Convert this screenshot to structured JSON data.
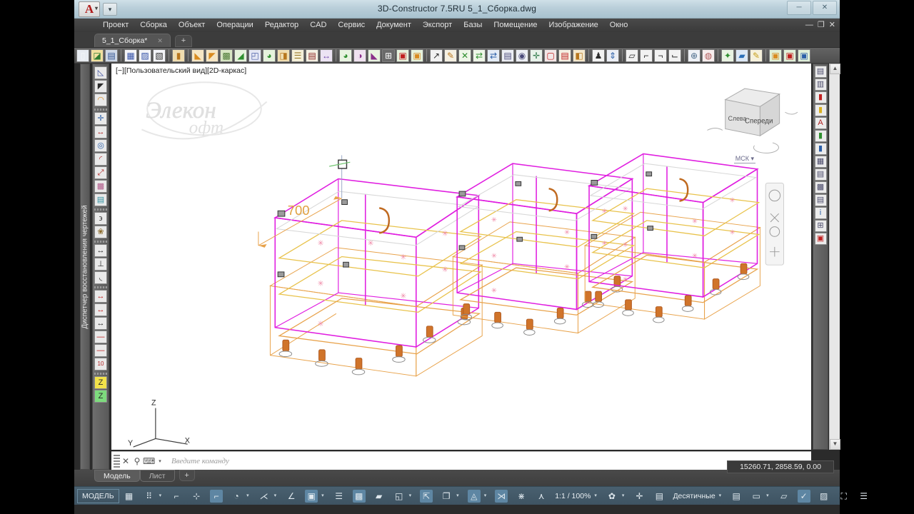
{
  "window": {
    "title": "3D-Constructor 7.5RU     5_1_Сборка.dwg",
    "app_button": "A",
    "app_caret": "▾",
    "qat_label": "▾",
    "min": "─",
    "max": "❐",
    "close": "✕",
    "inner_min": "—",
    "inner_max": "❐",
    "inner_close": "✕"
  },
  "menu": {
    "items": [
      "Проект",
      "Сборка",
      "Объект",
      "Операции",
      "Редактор",
      "CAD",
      "Сервис",
      "Документ",
      "Экспорт",
      "Базы",
      "Помещение",
      "Изображение",
      "Окно"
    ]
  },
  "tabs": {
    "items": [
      {
        "label": "5_1_Сборка*",
        "close": "✕"
      }
    ],
    "add": "+"
  },
  "toolbar": {
    "groups": [
      {
        "icons": [
          {
            "name": "new-file-icon",
            "glyph": "▯",
            "fg": "#f4f6fa",
            "bg": "#e8ecf2"
          },
          {
            "name": "open-file-icon",
            "glyph": "◪",
            "fg": "#2f7d32",
            "bg": "#f1e0a0"
          },
          {
            "name": "save-file-icon",
            "glyph": "▤",
            "fg": "#2b4f8e",
            "bg": "#cfd9e8"
          }
        ]
      },
      {
        "icons": [
          {
            "name": "object-box-icon",
            "glyph": "▦",
            "fg": "#3552a8",
            "bg": "#f3f4f8"
          },
          {
            "name": "object-edit-icon",
            "glyph": "▨",
            "fg": "#3552a8",
            "bg": "#f3f4f8"
          },
          {
            "name": "object-move-icon",
            "glyph": "▧",
            "fg": "#2c2c2c",
            "bg": "#f3f4f8"
          }
        ]
      },
      {
        "icons": [
          {
            "name": "panel-icon",
            "glyph": "▮",
            "fg": "#b8761d",
            "bg": "#f0ddb0"
          }
        ]
      },
      {
        "icons": [
          {
            "name": "contour-a-icon",
            "glyph": "◣",
            "fg": "#d98b20",
            "bg": "#f6e6c4"
          },
          {
            "name": "contour-b-icon",
            "glyph": "◤",
            "fg": "#d98b20",
            "bg": "#f6e6c4"
          },
          {
            "name": "texture-icon",
            "glyph": "▩",
            "fg": "#4c7a36",
            "bg": "#d8e6c4"
          },
          {
            "name": "green-face-icon",
            "glyph": "◢",
            "fg": "#2f8f2f",
            "bg": "#e6f2dc"
          },
          {
            "name": "profile-icon",
            "glyph": "◰",
            "fg": "#4a5fa8",
            "bg": "#e4e7f4"
          },
          {
            "name": "green-arc-icon",
            "glyph": "◕",
            "fg": "#2f8f2f",
            "bg": "#e6f2dc"
          },
          {
            "name": "door-icon",
            "glyph": "◨",
            "fg": "#b8761d",
            "bg": "#f0ddb0"
          },
          {
            "name": "list-rows-icon",
            "glyph": "☰",
            "fg": "#9a7a2a",
            "bg": "#f4efd8"
          },
          {
            "name": "report-icon",
            "glyph": "▤",
            "fg": "#8a1f1f",
            "bg": "#f4f0e2"
          },
          {
            "name": "dim-link-icon",
            "glyph": "↔",
            "fg": "#6a3fa8",
            "bg": "#ece4f4"
          }
        ]
      },
      {
        "icons": [
          {
            "name": "shade-green-icon",
            "glyph": "◕",
            "fg": "#2f8f2f",
            "bg": "#e8f3e0"
          },
          {
            "name": "shade-split-icon",
            "glyph": "◑",
            "fg": "#8a2f8a",
            "bg": "#f0e2f0"
          },
          {
            "name": "shade-flat-icon",
            "glyph": "◣",
            "fg": "#8a2f8a",
            "bg": "#e8f3e0"
          },
          {
            "name": "grid-table-icon",
            "glyph": "⊞",
            "fg": "#ffffff",
            "bg": "#6a6a6a"
          },
          {
            "name": "block-red-icon",
            "glyph": "▣",
            "fg": "#c02020",
            "bg": "#e6f2dc"
          },
          {
            "name": "block-orange-icon",
            "glyph": "▣",
            "fg": "#d98b20",
            "bg": "#e6f2dc"
          }
        ]
      },
      {
        "icons": [
          {
            "name": "select-cursor-icon",
            "glyph": "↗",
            "fg": "#2b2b2b",
            "bg": "#f2f2f2"
          },
          {
            "name": "magic-wand-icon",
            "glyph": "✎",
            "fg": "#b8761d",
            "bg": "#f5f0e2"
          },
          {
            "name": "section-icon",
            "glyph": "✕",
            "fg": "#2f8f2f",
            "bg": "#eef5e8"
          },
          {
            "name": "swap-green-icon",
            "glyph": "⇄",
            "fg": "#2f8f2f",
            "bg": "#eef5e8"
          },
          {
            "name": "swap-blue-icon",
            "glyph": "⇄",
            "fg": "#2b5fa8",
            "bg": "#e4ecf6"
          },
          {
            "name": "page-icon",
            "glyph": "▤",
            "fg": "#4a4a7a",
            "bg": "#eceef4"
          },
          {
            "name": "eye-icon",
            "glyph": "◉",
            "fg": "#4a4a7a",
            "bg": "#eceef4"
          },
          {
            "name": "move-cross-icon",
            "glyph": "✛",
            "fg": "#2f7a4a",
            "bg": "#e8f2ea"
          },
          {
            "name": "frame-red-icon",
            "glyph": "▢",
            "fg": "#c02020",
            "bg": "#f2e6e6"
          },
          {
            "name": "split-red-icon",
            "glyph": "▤",
            "fg": "#c02020",
            "bg": "#f4efe2"
          },
          {
            "name": "tool-amber-icon",
            "glyph": "◧",
            "fg": "#b8761d",
            "bg": "#f4e8cc"
          }
        ]
      },
      {
        "icons": [
          {
            "name": "people-icon",
            "glyph": "♟",
            "fg": "#2b2b2b",
            "bg": "#f2f2f2"
          },
          {
            "name": "height-icon",
            "glyph": "⇕",
            "fg": "#2b5fa8",
            "bg": "#eceff6"
          }
        ]
      },
      {
        "icons": [
          {
            "name": "cube-wire-icon",
            "glyph": "▱",
            "fg": "#2b2b2b",
            "bg": "#f2f2f2"
          },
          {
            "name": "corner-1-icon",
            "glyph": "⌐",
            "fg": "#2b2b2b",
            "bg": "#f2f2f2"
          },
          {
            "name": "corner-2-icon",
            "glyph": "¬",
            "fg": "#2b2b2b",
            "bg": "#f2f2f2"
          },
          {
            "name": "corner-3-icon",
            "glyph": "⌙",
            "fg": "#2b2b2b",
            "bg": "#f2f2f2"
          }
        ]
      },
      {
        "icons": [
          {
            "name": "zoom-in-icon",
            "glyph": "⊕",
            "fg": "#4a6a8a",
            "bg": "#eef1f6"
          },
          {
            "name": "render-icon",
            "glyph": "◍",
            "fg": "#b05a5a",
            "bg": "#f6ecec"
          }
        ]
      },
      {
        "icons": [
          {
            "name": "paint-icon",
            "glyph": "✦",
            "fg": "#2f8f2f",
            "bg": "#e9f3e2"
          },
          {
            "name": "blue-cube-icon",
            "glyph": "▰",
            "fg": "#2b6fb8",
            "bg": "#dce8f6"
          },
          {
            "name": "pencil-icon",
            "glyph": "✎",
            "fg": "#c8a020",
            "bg": "#f6f1dc"
          }
        ]
      },
      {
        "icons": [
          {
            "name": "frame-green-1-icon",
            "glyph": "▣",
            "fg": "#d98b20",
            "bg": "#e0f0d8"
          },
          {
            "name": "frame-green-2-icon",
            "glyph": "▣",
            "fg": "#c02020",
            "bg": "#e0f0d8"
          },
          {
            "name": "frame-green-3-icon",
            "glyph": "▣",
            "fg": "#2b5fa8",
            "bg": "#e0f0d8"
          }
        ]
      }
    ]
  },
  "left_panel": {
    "vertical_label": "Диспетчер восстановления чертежей",
    "tools": [
      {
        "name": "line-tool-icon",
        "glyph": "◺",
        "fg": "#3b4fa0"
      },
      {
        "name": "polyline-tool-icon",
        "glyph": "◤",
        "fg": "#2b2b2b"
      },
      {
        "name": "arc-fill-tool-icon",
        "glyph": "◠",
        "fg": "#d98b20"
      },
      {
        "name": "point-tool-icon",
        "glyph": "✛",
        "fg": "#2b5fa8"
      },
      {
        "name": "dim-linear-icon",
        "glyph": "↔",
        "fg": "#b02020"
      },
      {
        "name": "circle-tool-icon",
        "glyph": "◎",
        "fg": "#2b5fa8"
      },
      {
        "name": "dim-angular-icon",
        "glyph": "◜",
        "fg": "#b02020"
      },
      {
        "name": "dim-aligned-icon",
        "glyph": "⤢",
        "fg": "#b02020"
      },
      {
        "name": "hatch-tool-icon",
        "glyph": "▩",
        "fg": "#b05a8a"
      },
      {
        "name": "table-tool-icon",
        "glyph": "▤",
        "fg": "#2f8f9f"
      },
      {
        "name": "spline-tool-icon",
        "glyph": "϶",
        "fg": "#2b2b2b"
      },
      {
        "name": "block-insert-icon",
        "glyph": "❀",
        "fg": "#8a6a2a"
      },
      {
        "name": "measure-width-icon",
        "glyph": "↔",
        "fg": "#2b2b2b"
      },
      {
        "name": "measure-edge-icon",
        "glyph": "⊥",
        "fg": "#2b2b2b"
      },
      {
        "name": "fillet-icon",
        "glyph": "◟",
        "fg": "#2b2b2b"
      },
      {
        "name": "quick-dim-1-icon",
        "glyph": "↔",
        "fg": "#c02020"
      },
      {
        "name": "quick-dim-2-icon",
        "glyph": "↔",
        "fg": "#c02020"
      },
      {
        "name": "quick-dim-3-icon",
        "glyph": "↔",
        "fg": "#2b2b2b"
      },
      {
        "name": "dim-text-1-icon",
        "glyph": "—",
        "fg": "#c02020"
      },
      {
        "name": "dim-text-2-icon",
        "glyph": "—",
        "fg": "#c02020"
      },
      {
        "name": "label-10-icon",
        "glyph": "10",
        "fg": "#b02020"
      },
      {
        "name": "z-yellow-icon",
        "glyph": "Z",
        "fg": "#2b2b2b"
      },
      {
        "name": "z-green-icon",
        "glyph": "Z",
        "fg": "#2b2b2b"
      }
    ]
  },
  "right_panel": {
    "tools": [
      {
        "name": "nav-panel-icon",
        "glyph": "▤",
        "fg": "#4a4a6a"
      },
      {
        "name": "nav-stack-icon",
        "glyph": "▥",
        "fg": "#4a4a6a"
      },
      {
        "name": "palette-red-icon",
        "glyph": "▮",
        "fg": "#c02020"
      },
      {
        "name": "palette-yellow-icon",
        "glyph": "▮",
        "fg": "#d9b020"
      },
      {
        "name": "palette-a-icon",
        "glyph": "A",
        "fg": "#b02020"
      },
      {
        "name": "palette-green-icon",
        "glyph": "▮",
        "fg": "#2f8f2f"
      },
      {
        "name": "palette-blue-icon",
        "glyph": "▮",
        "fg": "#2b5fa8"
      },
      {
        "name": "tool-props-icon",
        "glyph": "▦",
        "fg": "#4a4a6a"
      },
      {
        "name": "tool-layers-icon",
        "glyph": "▤",
        "fg": "#4a4a6a"
      },
      {
        "name": "tool-calc-icon",
        "glyph": "▩",
        "fg": "#4a4a6a"
      },
      {
        "name": "tool-sheet-icon",
        "glyph": "▤",
        "fg": "#4a4a6a"
      },
      {
        "name": "tool-info-icon",
        "glyph": "i",
        "fg": "#2b5fa8"
      },
      {
        "name": "tool-grid-icon",
        "glyph": "⊞",
        "fg": "#4a4a6a"
      },
      {
        "name": "tool-red-icon",
        "glyph": "▣",
        "fg": "#c02020"
      }
    ]
  },
  "canvas": {
    "view_label": "[−][Пользовательский вид][2D-каркас]",
    "ucs_label": "МСК",
    "ucs_caret": "▾",
    "viewcube": {
      "left_face": "Слева",
      "front_face": "Спереди"
    },
    "dimension_value": "700",
    "axis_labels": {
      "z": "Z",
      "y": "Y",
      "x": "X"
    },
    "watermark": "Элекон Софт"
  },
  "command_line": {
    "placeholder": "Введите  команду",
    "close_icon": "✕",
    "settings_icon": "⚲",
    "prompt_icon": "⌨",
    "prompt_caret": "▾"
  },
  "model_tabs": {
    "model": "Модель",
    "layout": "Лист",
    "add": "+",
    "coordinates": "15260.71, 2858.59, 0.00"
  },
  "status_bar": {
    "model_label": "МОДЕЛЬ",
    "items": [
      {
        "name": "grid-display-toggle",
        "glyph": "▦",
        "on": false
      },
      {
        "name": "snap-mode-toggle",
        "glyph": "⠿",
        "on": false,
        "caret": "▾"
      },
      {
        "name": "ortho-mode-toggle",
        "glyph": "⌐",
        "on": false
      },
      {
        "name": "polar-tracking-toggle",
        "glyph": "⊹",
        "on": false
      },
      {
        "name": "osnap-toggle",
        "glyph": "⌐",
        "on": true
      },
      {
        "name": "3d-osnap-toggle",
        "glyph": "◔",
        "on": false,
        "caret": "▾"
      },
      {
        "name": "otrack-toggle",
        "glyph": "⋌",
        "on": false,
        "caret": "▾"
      },
      {
        "name": "ducs-toggle",
        "glyph": "∠",
        "on": false
      },
      {
        "name": "dyn-input-toggle",
        "glyph": "▣",
        "on": true,
        "caret": "▾"
      },
      {
        "name": "lineweight-toggle",
        "glyph": "☰",
        "on": false
      },
      {
        "name": "transparency-toggle",
        "glyph": "▩",
        "on": true
      },
      {
        "name": "selection-cycling-toggle",
        "glyph": "▰",
        "on": false
      },
      {
        "name": "annotation-visibility-toggle",
        "glyph": "◱",
        "on": false,
        "caret": "▾"
      },
      {
        "name": "autoscale-toggle",
        "glyph": "⇱",
        "on": true
      },
      {
        "name": "workspace-switch-icon",
        "glyph": "❐",
        "on": false,
        "caret": "▾"
      },
      {
        "name": "isolate-objects-icon",
        "glyph": "◬",
        "on": true,
        "caret": "▾"
      },
      {
        "name": "annotation-scale-icon",
        "glyph": "⋊",
        "on": true
      },
      {
        "name": "annotation-add-icon",
        "glyph": "⋇",
        "on": false
      },
      {
        "name": "annotation-person-icon",
        "glyph": "⋏",
        "on": false
      },
      {
        "name": "scale-label",
        "text": "1:1 / 100%",
        "caret": "▾"
      },
      {
        "name": "settings-gear-icon",
        "glyph": "✿",
        "on": false,
        "caret": "▾"
      },
      {
        "name": "add-scale-icon",
        "glyph": "✛",
        "on": false
      },
      {
        "name": "units-icon",
        "glyph": "▤",
        "on": false
      },
      {
        "name": "units-label",
        "text": "Десятичные",
        "caret": "▾"
      },
      {
        "name": "quick-properties-icon",
        "glyph": "▤",
        "on": false
      },
      {
        "name": "clean-screen-icon",
        "glyph": "▭",
        "on": false,
        "caret": "▾"
      },
      {
        "name": "model-space-icon",
        "glyph": "▱",
        "on": false
      },
      {
        "name": "lock-ui-icon",
        "glyph": "✓",
        "on": true
      },
      {
        "name": "graphics-perf-icon",
        "glyph": "▨",
        "on": false
      },
      {
        "name": "fullscreen-icon",
        "glyph": "⛶",
        "on": false
      },
      {
        "name": "customization-icon",
        "glyph": "☰",
        "on": false
      }
    ]
  }
}
